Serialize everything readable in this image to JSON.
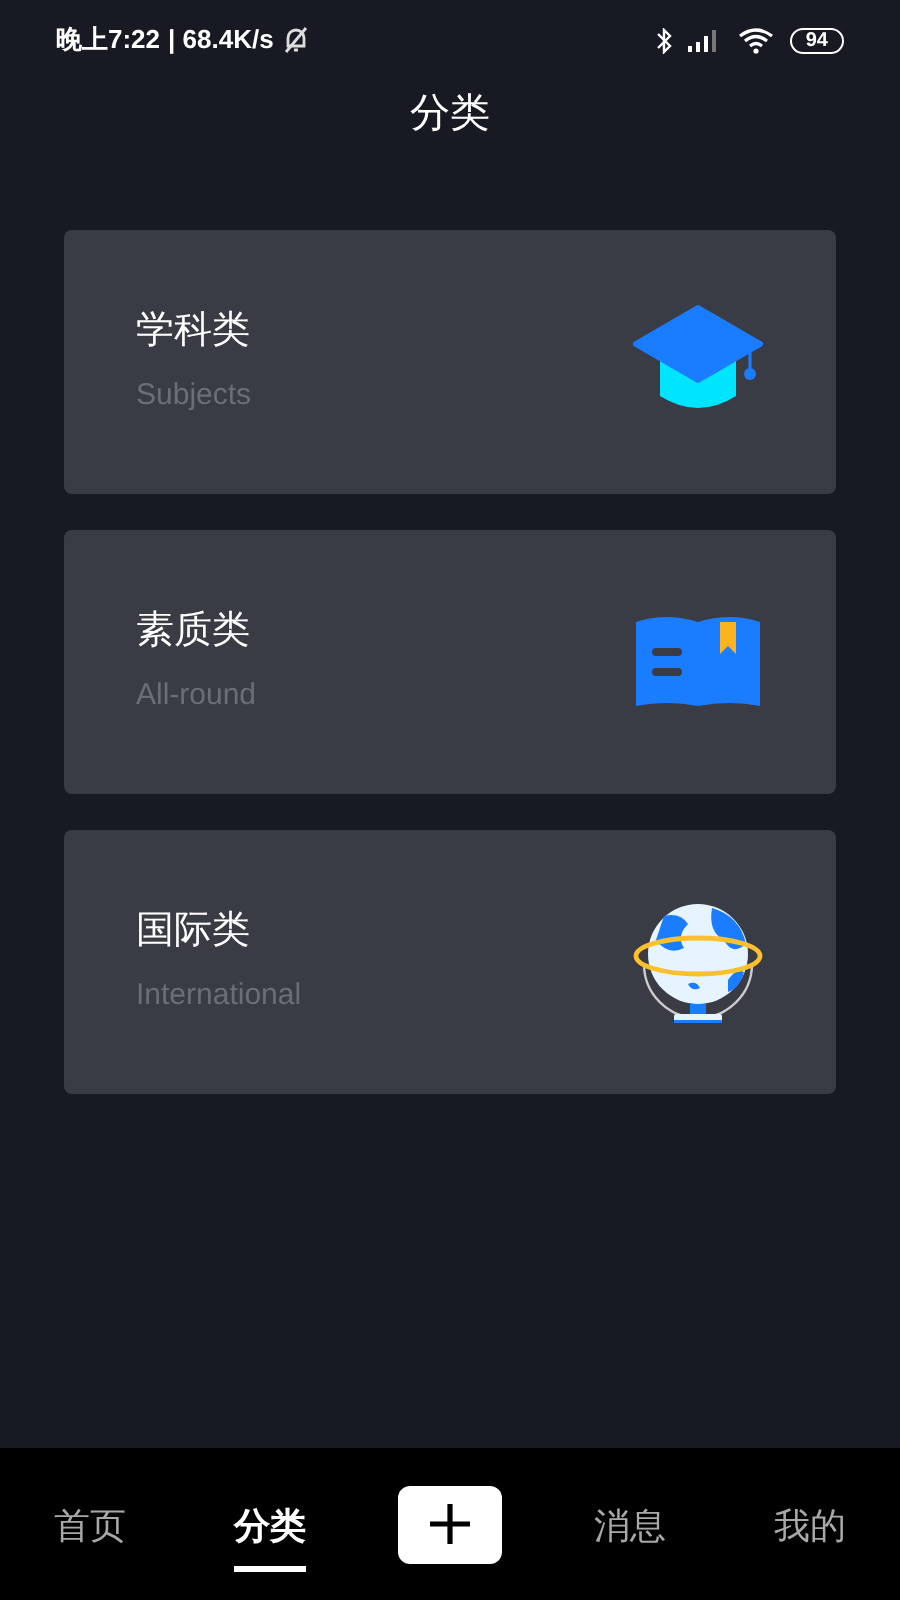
{
  "status_bar": {
    "time": "晚上7:22",
    "speed": "| 68.4K/s",
    "battery": "94"
  },
  "title": "分类",
  "categories": [
    {
      "kind": "cap",
      "title": "学科类",
      "subtitle": "Subjects"
    },
    {
      "kind": "book",
      "title": "素质类",
      "subtitle": "All-round"
    },
    {
      "kind": "globe",
      "title": "国际类",
      "subtitle": "International"
    }
  ],
  "nav": [
    {
      "kind": "tab",
      "label": "首页",
      "selected": false
    },
    {
      "kind": "tab",
      "label": "分类",
      "selected": true
    },
    {
      "kind": "add"
    },
    {
      "kind": "tab",
      "label": "消息",
      "selected": false
    },
    {
      "kind": "tab",
      "label": "我的",
      "selected": false
    }
  ]
}
